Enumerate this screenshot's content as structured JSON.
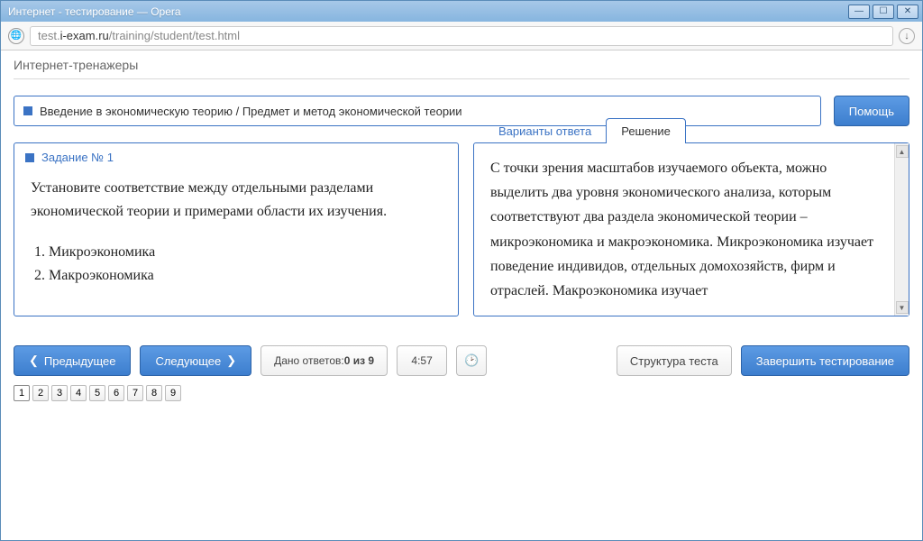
{
  "window": {
    "title": "Интернет - тестирование — Opera"
  },
  "addressbar": {
    "url_prefix": "test.",
    "url_host": "i-exam.ru",
    "url_path": "/training/student/test.html"
  },
  "page_title": "Интернет-тренажеры",
  "topic": "Введение в экономическую теорию / Предмет и метод экономической теории",
  "buttons": {
    "help": "Помощь",
    "prev": "Предыдущее",
    "next": "Следующее",
    "structure": "Структура теста",
    "finish": "Завершить тестирование"
  },
  "task": {
    "label": "Задание № 1",
    "prompt": "Установите соответствие между отдельными разделами экономической теории и примерами области их изучения.",
    "items": [
      "Микроэкономика",
      "Макроэкономика"
    ]
  },
  "tabs": {
    "answers": "Варианты ответа",
    "solution": "Решение"
  },
  "solution_text": "С точки зрения масштабов изучаемого объекта, можно выделить два уровня экономического анализа, которым соответствуют два раздела экономической теории – микроэкономика и макроэкономика. Микроэкономика изучает поведение индивидов, отдельных домохозяйств, фирм и отраслей. Макроэкономика изучает",
  "progress": {
    "label": "Дано ответов: ",
    "value": "0 из 9"
  },
  "timer": "4:57",
  "pager": [
    "1",
    "2",
    "3",
    "4",
    "5",
    "6",
    "7",
    "8",
    "9"
  ]
}
